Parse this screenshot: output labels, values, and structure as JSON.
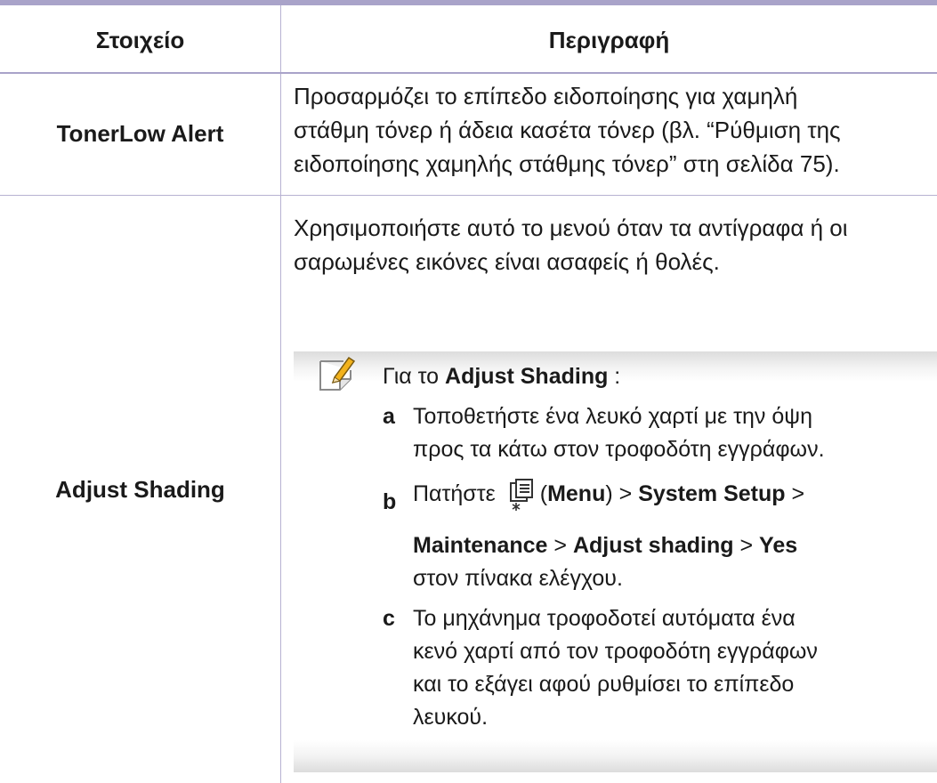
{
  "headers": {
    "item": "Στοιχείο",
    "description": "Περιγραφή"
  },
  "rows": [
    {
      "item": "TonerLow Alert",
      "description": [
        "Προσαρμόζει το επίπεδο ειδοποίησης για χαμηλή",
        "στάθμη τόνερ ή άδεια κασέτα τόνερ (βλ. “Ρύθμιση της",
        "ειδοποίησης χαμηλής στάθμης τόνερ” στη σελίδα 75)."
      ]
    },
    {
      "item": "Adjust Shading",
      "description": [
        "Χρησιμοποιήστε αυτό το μενού όταν τα αντίγραφα ή οι",
        "σαρωμένες εικόνες είναι ασαφείς ή θολές."
      ],
      "note": {
        "icon": "note-pencil-icon",
        "intro_prefix": "Για το ",
        "intro_bold": "Adjust Shading",
        "intro_suffix": " :",
        "steps": [
          {
            "letter": "a",
            "lines": [
              "Τοποθετήστε ένα λευκό χαρτί με την όψη",
              "προς τα κάτω στον τροφοδότη εγγράφων."
            ]
          },
          {
            "letter": "b",
            "press": "Πατήστε",
            "menu_icon": "menu-icon",
            "menu_open": "(",
            "menu_label": "Menu",
            "menu_close": ")",
            "sep": ">",
            "system_setup": "System Setup",
            "maintenance": "Maintenance",
            "adjust_shading": "Adjust shading",
            "yes": "Yes",
            "panel": "στον πίνακα ελέγχου."
          },
          {
            "letter": "c",
            "lines": [
              "Το μηχάνημα τροφοδοτεί αυτόματα ένα",
              "κενό χαρτί από τον τροφοδότη εγγράφων",
              "και το εξάγει αφού ρυθμίσει το επίπεδο",
              "λευκού."
            ]
          }
        ]
      }
    }
  ]
}
